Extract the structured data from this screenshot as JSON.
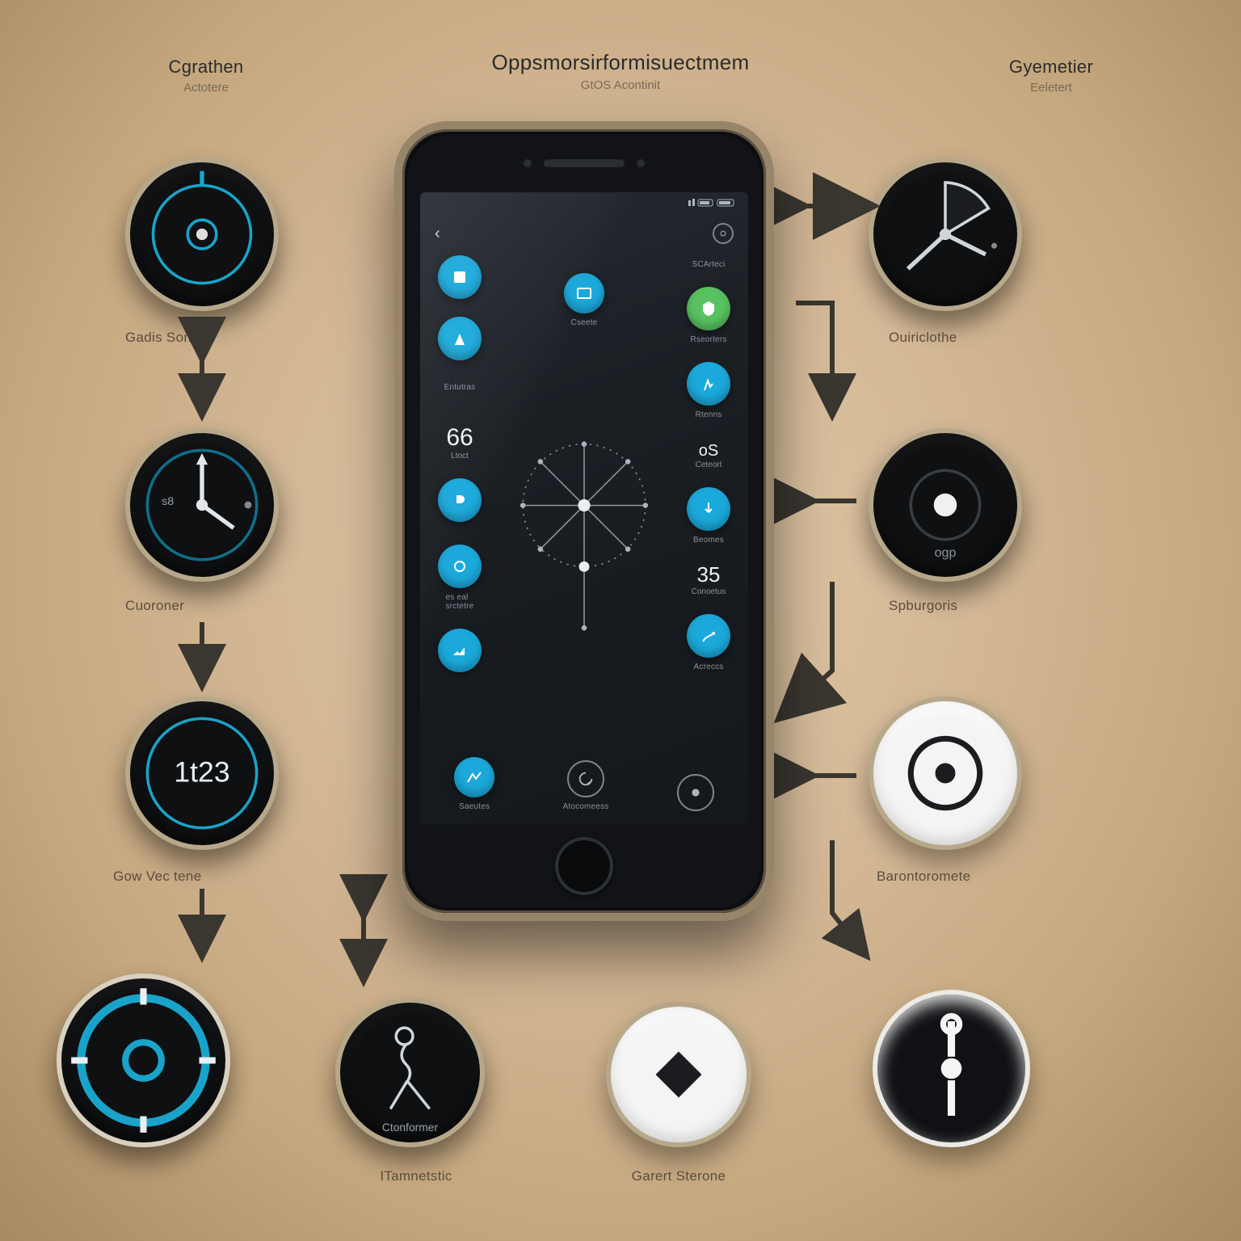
{
  "headers": {
    "left": {
      "title": "Cgrathen",
      "subtitle": "Actotere"
    },
    "center": {
      "title": "Oppsmorsirformisuectmem",
      "subtitle": "GtOS Acontinit"
    },
    "right": {
      "title": "Gyemetier",
      "subtitle": "Eeletert"
    }
  },
  "pucks": {
    "l1": {
      "label": "Gadis Sonther"
    },
    "l2": {
      "label": "Cuoroner",
      "readout": "s8"
    },
    "l3": {
      "label": "Gow Vec tene",
      "readout": "1t23"
    },
    "b1": {
      "label": ""
    },
    "b2": {
      "label": "ITamnetstic",
      "sub": "Ctonformer"
    },
    "b3": {
      "label": "Garert Sterone"
    },
    "b4": {
      "label": ""
    },
    "r1": {
      "label": "Ouiriclothe"
    },
    "r2": {
      "label": "Spburgoris",
      "sub": "ogp"
    },
    "r3": {
      "label": "Barontoromete"
    }
  },
  "phone": {
    "statusbar": {
      "left": "",
      "right": ""
    },
    "topring": "",
    "left_col": [
      {
        "label": ""
      },
      {
        "label": "Entutras"
      },
      {
        "label": ""
      },
      {
        "label": "es eal\nsrctetre"
      }
    ],
    "right_col": [
      {
        "label": "SCArteci"
      },
      {
        "label": "Rseorters"
      },
      {
        "label": "Rtenns"
      },
      {
        "label": "Beomes"
      },
      {
        "label": "Acreccs"
      }
    ],
    "center_top": {
      "label": "Cseete"
    },
    "metrics": {
      "big": {
        "value": "66",
        "label": "Ltoct"
      },
      "small": {
        "value": "oS",
        "label": "Ceteort"
      },
      "right": {
        "value": "35",
        "label": "Conoetus"
      }
    },
    "bottom": [
      {
        "label": "Saeutes"
      },
      {
        "label": "Atocomeess"
      },
      {
        "label": ""
      }
    ]
  }
}
